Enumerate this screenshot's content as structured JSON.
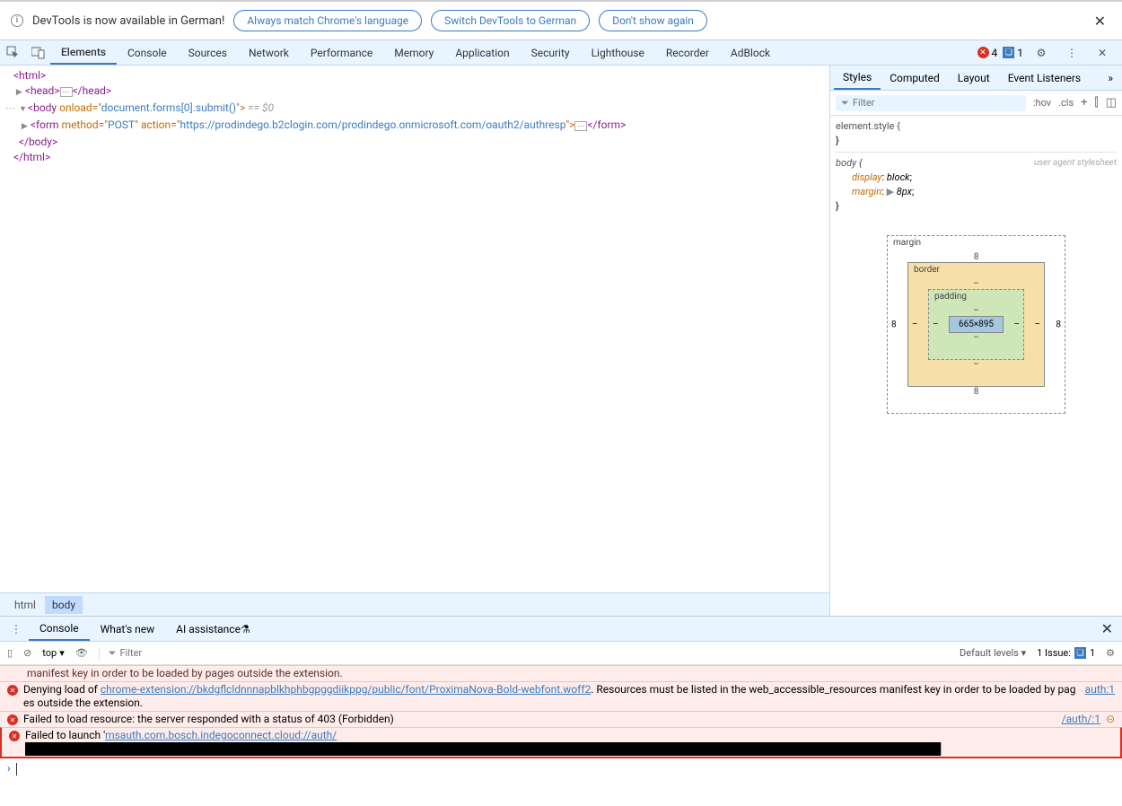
{
  "infobar": {
    "text": "DevTools is now available in German!",
    "btn1": "Always match Chrome's language",
    "btn2": "Switch DevTools to German",
    "btn3": "Don't show again"
  },
  "toolbar": {
    "tabs": [
      "Elements",
      "Console",
      "Sources",
      "Network",
      "Performance",
      "Memory",
      "Application",
      "Security",
      "Lighthouse",
      "Recorder",
      "AdBlock"
    ],
    "active": 0,
    "errors": "4",
    "issues": "1"
  },
  "dom": {
    "l1": "<html>",
    "l2_open": "<head>",
    "l2_close": "</head>",
    "l3_pre": "<body ",
    "l3_attr": "onload",
    "l3_eq": "=\"",
    "l3_val": "document.forms[0].submit()",
    "l3_post": "\">",
    "l3_marker": " == $0",
    "l4_pre": "<form ",
    "l4_a1": "method",
    "l4_v1": "POST",
    "l4_a2": "action",
    "l4_v2": "https://prodindego.b2clogin.com/prodindego.onmicrosoft.com/oauth2/authresp",
    "l4_close": "</form>",
    "l5": "</body>",
    "l6": "</html>"
  },
  "breadcrumb": {
    "item1": "html",
    "item2": "body"
  },
  "styles": {
    "tabs": [
      "Styles",
      "Computed",
      "Layout",
      "Event Listeners"
    ],
    "filter_ph": "Filter",
    "hov": ":hov",
    "cls": ".cls",
    "rule1_sel": "element.style {",
    "rule1_close": "}",
    "rule2_sel": "body {",
    "rule2_ua": "user agent stylesheet",
    "p1_name": "display",
    "p1_val": "block",
    "p2_name": "margin",
    "p2_val": "8px",
    "rule2_close": "}"
  },
  "boxmodel": {
    "margin": "margin",
    "margin_v": "8",
    "border": "border",
    "border_v": "–",
    "padding": "padding",
    "padding_v": "–",
    "content": "665×895"
  },
  "drawer": {
    "tabs": [
      "Console",
      "What's new",
      "AI assistance"
    ],
    "context": "top",
    "filter_ph": "Filter",
    "levels": "Default levels",
    "issue_text": "1 Issue:",
    "issue_n": "1"
  },
  "console": {
    "msg0": "manifest key in order to be loaded by pages outside the extension.",
    "msg1_a": "Denying load of ",
    "msg1_link": "chrome-extension://bkdgflcldnnnapblkhphbgpggdiikppg/public/font/ProximaNova-Bold-webfont.woff2",
    "msg1_b": ". Resources must be listed in the web_accessible_resources manifest key in order to be loaded by pages outside the extension.",
    "msg1_src": "auth:1",
    "msg2": "Failed to load resource: the server responded with a status of 403 (Forbidden)",
    "msg2_src": "/auth/:1",
    "msg3_a": "Failed to launch '",
    "msg3_link": "msauth.com.bosch.indegoconnect.cloud://auth/",
    "msg3_redact": "████████████████████████████████████████████████████████████████████████████████████████████████████████████████████████"
  }
}
